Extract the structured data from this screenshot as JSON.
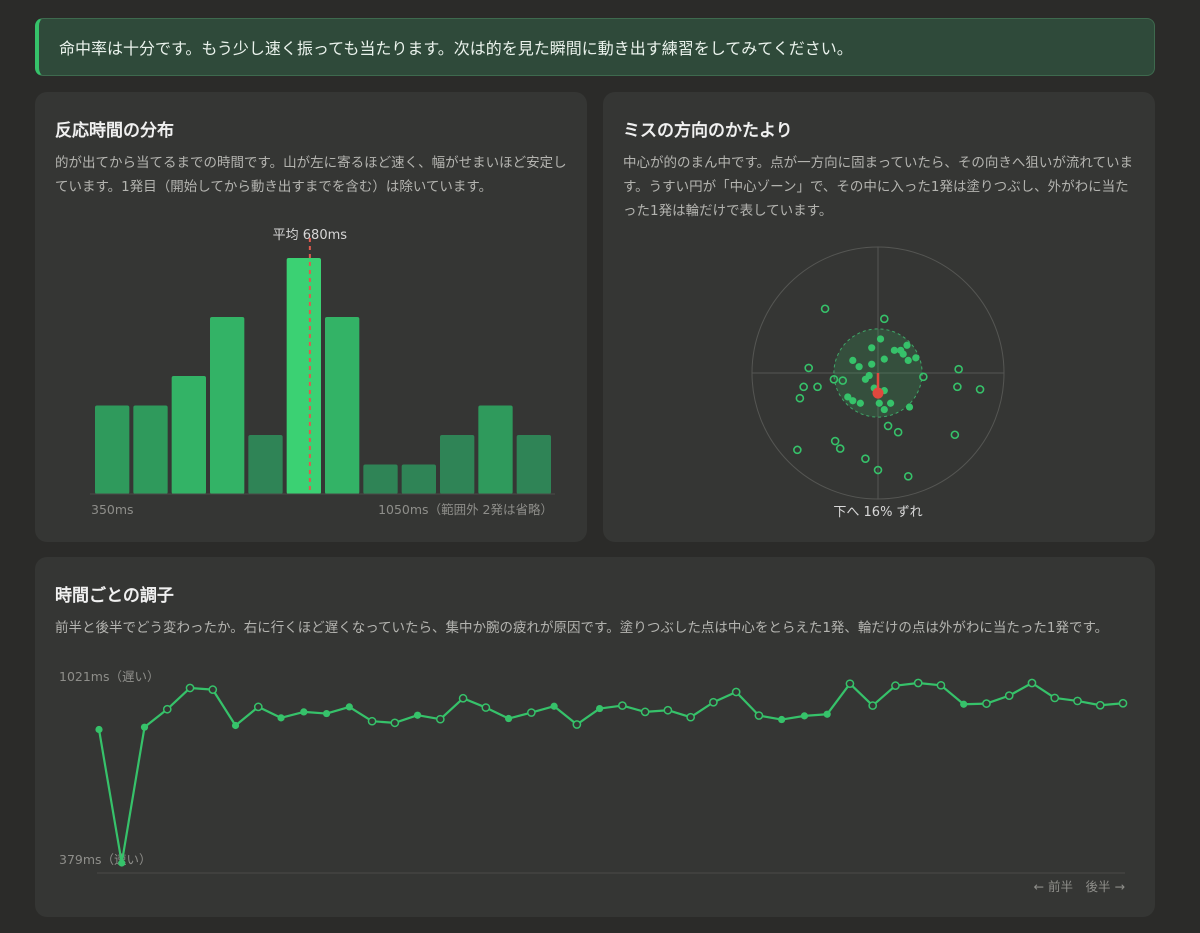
{
  "banner": {
    "message": "命中率は十分です。もう少し速く振っても当たります。次は的を見た瞬間に動き出す練習をしてみてください。"
  },
  "cards": {
    "histogram": {
      "title": "反応時間の分布",
      "description": "的が出てから当てるまでの時間です。山が左に寄るほど速く、幅がせまいほど安定しています。1発目（開始してから動き出すまでを含む）は除いています。",
      "mean_label": "平均 680ms",
      "min_label": "350ms",
      "max_label": "1050ms（範囲外 2発は省略）"
    },
    "miss": {
      "title": "ミスの方向のかたより",
      "description": "中心が的のまん中です。点が一方向に固まっていたら、その向きへ狙いが流れています。うすい円が「中心ゾーン」で、その中に入った1発は塗りつぶし、外がわに当たった1発は輪だけで表しています。",
      "bias_label": "下へ 16% ずれ"
    },
    "timeline": {
      "title": "時間ごとの調子",
      "description": "前半と後半でどう変わったか。右に行くほど遅くなっていたら、集中か腕の疲れが原因です。塗りつぶした点は中心をとらえた1発、輪だけの点は外がわに当たった1発です。",
      "max_label": "1021ms（遅い）",
      "min_label": "379ms（速い）",
      "axis_label": "← 前半　後半 →"
    }
  },
  "colors": {
    "accent": "#36c26a",
    "bar_dark": "#2f8f58",
    "bar_bright": "#3bd173",
    "mean_line": "#e05a4e",
    "bias_arrow": "#e0483e",
    "grid": "#555653",
    "muted_text": "#8e8e8a"
  },
  "chart_data": [
    {
      "type": "bar",
      "name": "reaction-time-histogram",
      "bin_start_ms": 350,
      "bin_end_ms": 1050,
      "values": [
        3,
        3,
        4,
        6,
        2,
        8,
        6,
        1,
        1,
        2,
        3,
        2
      ],
      "highlight_bin": 5,
      "mean_ms": 680
    },
    {
      "type": "scatter",
      "name": "miss-direction",
      "xlim": [
        -1,
        1
      ],
      "ylim": [
        -1,
        1
      ],
      "center_zone_radius": 0.35,
      "bias_vector": [
        0,
        -0.16
      ],
      "points_in_zone": [
        [
          0.23,
          0.22
        ],
        [
          0.2,
          0.15
        ],
        [
          0.24,
          0.1
        ],
        [
          0.18,
          0.18
        ],
        [
          0.3,
          0.12
        ],
        [
          -0.05,
          0.2
        ],
        [
          -0.2,
          0.1
        ],
        [
          -0.15,
          0.05
        ],
        [
          -0.05,
          0.07
        ],
        [
          -0.1,
          -0.05
        ],
        [
          -0.24,
          -0.19
        ],
        [
          -0.2,
          -0.22
        ],
        [
          -0.14,
          -0.24
        ],
        [
          0.01,
          -0.24
        ],
        [
          0.05,
          -0.29
        ],
        [
          0.1,
          -0.24
        ],
        [
          0.05,
          -0.14
        ],
        [
          -0.03,
          -0.12
        ],
        [
          0.25,
          -0.27
        ],
        [
          0.02,
          0.27
        ],
        [
          0.05,
          0.11
        ],
        [
          0.13,
          0.18
        ],
        [
          -0.07,
          -0.02
        ]
      ],
      "points_outside": [
        [
          -0.42,
          0.51
        ],
        [
          0.05,
          0.43
        ],
        [
          -0.55,
          0.04
        ],
        [
          -0.28,
          -0.06
        ],
        [
          -0.48,
          -0.11
        ],
        [
          -0.35,
          -0.05
        ],
        [
          -0.59,
          -0.11
        ],
        [
          -0.62,
          -0.2
        ],
        [
          0.36,
          -0.03
        ],
        [
          0.64,
          0.03
        ],
        [
          0.63,
          -0.11
        ],
        [
          0.81,
          -0.13
        ],
        [
          0.08,
          -0.42
        ],
        [
          0.16,
          -0.47
        ],
        [
          0.61,
          -0.49
        ],
        [
          -0.34,
          -0.54
        ],
        [
          -0.3,
          -0.6
        ],
        [
          -0.64,
          -0.61
        ],
        [
          -0.1,
          -0.68
        ],
        [
          0.0,
          -0.77
        ],
        [
          0.24,
          -0.82
        ]
      ]
    },
    {
      "type": "line",
      "name": "reaction-time-over-session",
      "ylim": [
        379,
        1021
      ],
      "values": [
        760,
        358,
        767,
        821,
        885,
        880,
        772,
        828,
        795,
        813,
        808,
        828,
        785,
        780,
        803,
        791,
        854,
        826,
        793,
        811,
        830,
        775,
        823,
        832,
        813,
        818,
        797,
        842,
        873,
        802,
        790,
        801,
        806,
        898,
        832,
        892,
        900,
        893,
        836,
        838,
        862,
        900,
        855,
        846,
        833,
        839
      ],
      "filled": [
        true,
        true,
        true,
        false,
        false,
        false,
        true,
        false,
        true,
        true,
        true,
        true,
        false,
        false,
        true,
        false,
        false,
        false,
        true,
        false,
        true,
        false,
        true,
        false,
        false,
        false,
        false,
        false,
        false,
        false,
        true,
        true,
        true,
        false,
        false,
        false,
        false,
        false,
        true,
        false,
        false,
        false,
        false,
        false,
        false,
        false
      ]
    }
  ]
}
